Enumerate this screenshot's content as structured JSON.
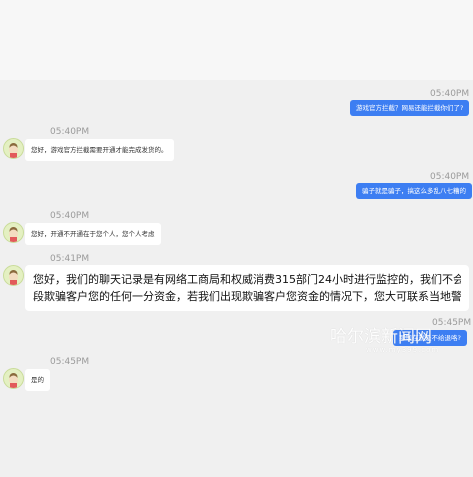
{
  "messages": [
    {
      "time": "05:40PM",
      "text": "游戏官方拦截？网易还能拦截你们了?"
    },
    {
      "time": "05:40PM",
      "text": "您好，游戏官方拦截需要开通才能完成发货的。"
    },
    {
      "time": "05:40PM",
      "text": "骗子就是骗子，搞这么多乱八七糟的"
    },
    {
      "time": "05:40PM",
      "text": "您好，开通不开通在于您个人，您个人考虑"
    },
    {
      "time": "05:41PM",
      "text_line1": "您好，我们的聊天记录是有网络工商局和权威消费315部门24小时进行监控的，我们不会使用任何非法手",
      "text_line2": "段欺骗客户您的任何一分资金，若我们出现欺骗客户您资金的情况下，您大可联系当地警方处理。"
    },
    {
      "time": "05:45PM",
      "text": "那现在就是不给退咯?"
    },
    {
      "time": "05:45PM",
      "text": "是的"
    }
  ],
  "watermark": {
    "title": "哈尔滨新闻网",
    "subtitle": "www.my399.com"
  },
  "colors": {
    "outgoing": "#3d7ef2",
    "incoming": "#ffffff",
    "background": "#f0f0f0"
  },
  "icons": {
    "avatar": "cartoon-avatar-icon"
  }
}
